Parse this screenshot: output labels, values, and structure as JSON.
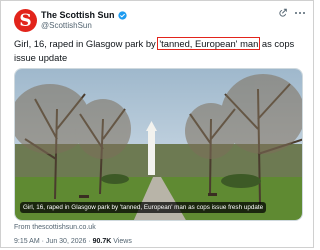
{
  "account": {
    "name": "The Scottish Sun",
    "handle": "@ScottishSun",
    "avatar_letter": "S",
    "brand_color": "#e2241b",
    "verified_color": "#1d9bf0"
  },
  "header_icons": [
    "grok-icon",
    "more-icon"
  ],
  "tweet": {
    "text_before": "Girl, 16, raped in Glasgow park by ",
    "text_highlight": "'tanned, European' man",
    "text_after": " as cops issue update",
    "highlight_color": "#e2241b"
  },
  "media": {
    "caption": "Girl, 16, raped in Glasgow park by 'tanned, European' man as cops issue fresh update"
  },
  "source": "From thescottishsun.co.uk",
  "meta": {
    "time": "9:15 AM",
    "separator1": " · ",
    "date": "Jun 30, 2026",
    "separator2": " · ",
    "views_count": "90.7K",
    "views_label": " Views"
  }
}
